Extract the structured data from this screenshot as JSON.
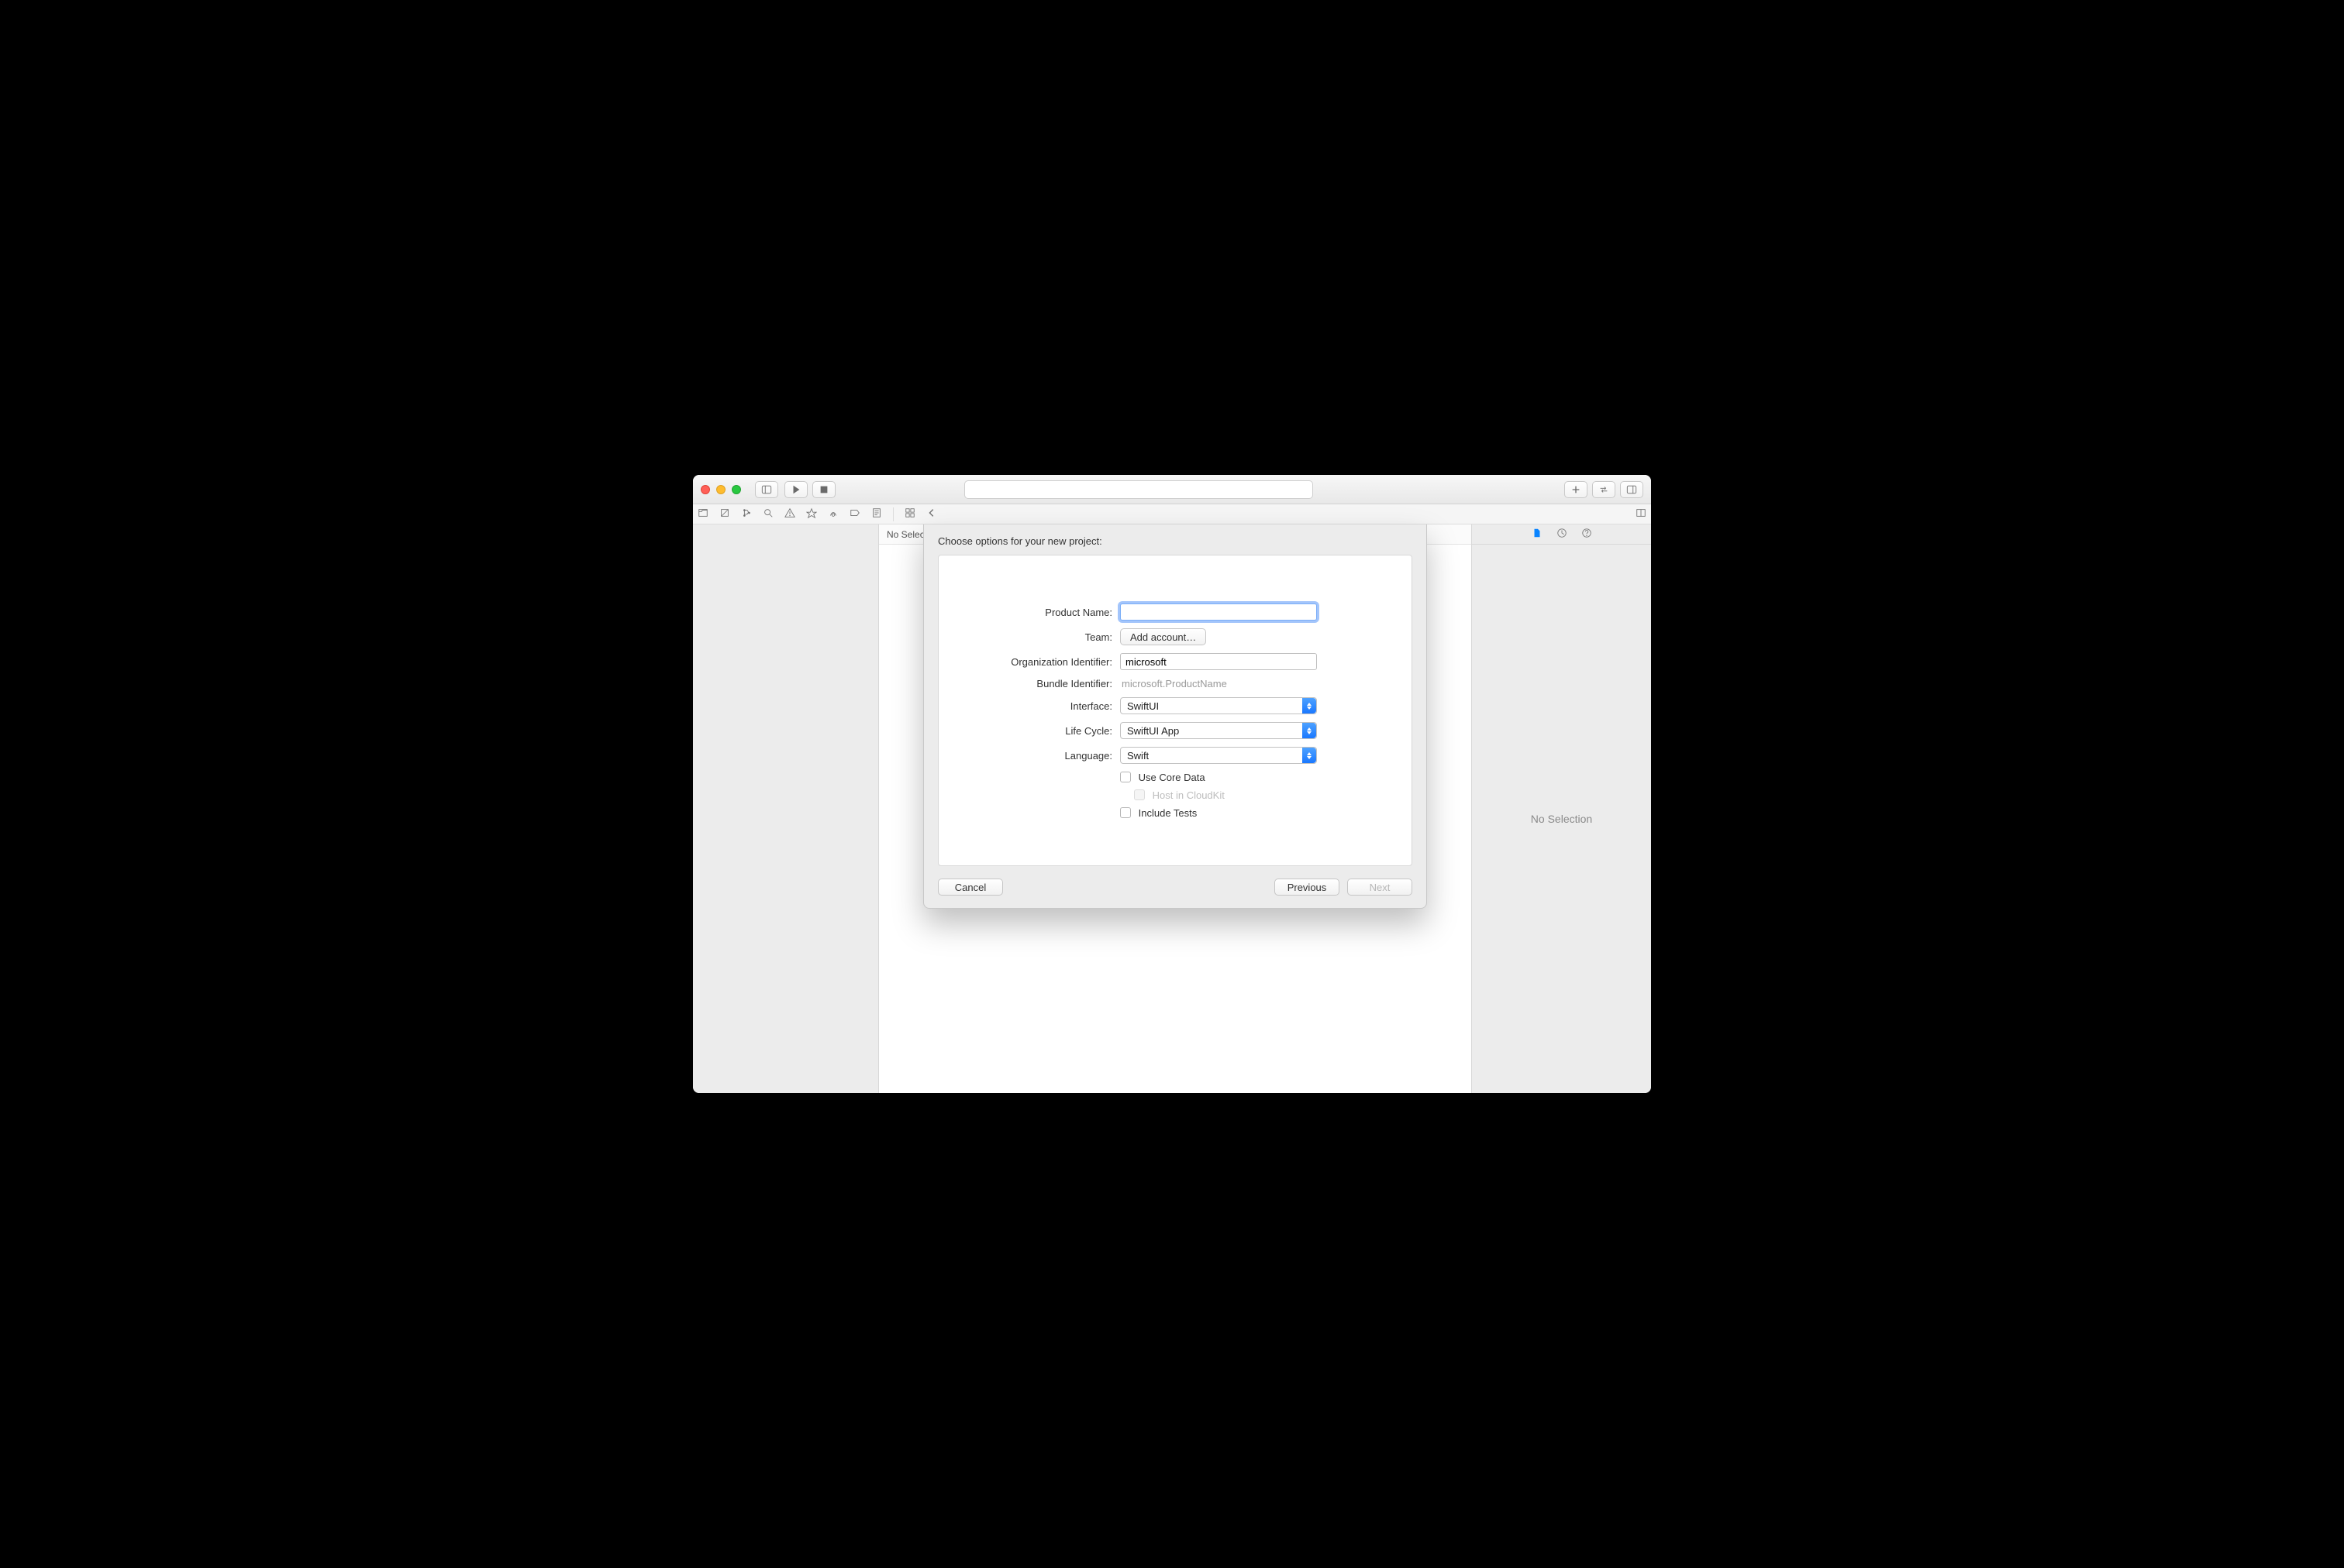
{
  "breadcrumb": "No Selection",
  "inspector_empty": "No Selection",
  "sheet": {
    "title": "Choose options for your new project:",
    "labels": {
      "product_name": "Product Name:",
      "team": "Team:",
      "org_id": "Organization Identifier:",
      "bundle_id": "Bundle Identifier:",
      "interface": "Interface:",
      "life_cycle": "Life Cycle:",
      "language": "Language:"
    },
    "values": {
      "product_name": "",
      "team_button": "Add account…",
      "org_id": "microsoft",
      "bundle_id": "microsoft.ProductName",
      "interface": "SwiftUI",
      "life_cycle": "SwiftUI App",
      "language": "Swift"
    },
    "checks": {
      "core_data": "Use Core Data",
      "cloudkit": "Host in CloudKit",
      "tests": "Include Tests"
    },
    "buttons": {
      "cancel": "Cancel",
      "previous": "Previous",
      "next": "Next"
    }
  }
}
